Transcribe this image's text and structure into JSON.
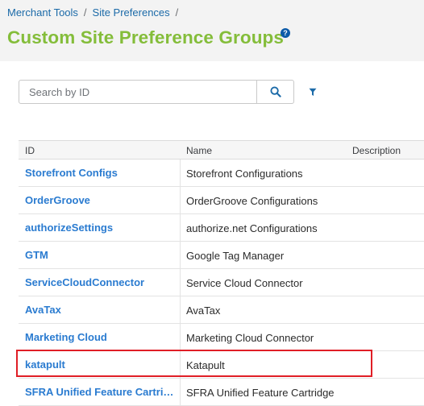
{
  "breadcrumb": {
    "items": [
      "Merchant Tools",
      "Site Preferences"
    ],
    "separator": "/"
  },
  "page": {
    "title": "Custom Site Preference Groups",
    "help_icon": "?"
  },
  "search": {
    "placeholder": "Search by ID",
    "value": ""
  },
  "icons": {
    "search": "search-icon",
    "filter": "filter-icon",
    "help": "help-icon"
  },
  "table": {
    "columns": [
      "ID",
      "Name",
      "Description"
    ],
    "rows": [
      {
        "id": "Storefront Configs",
        "name": "Storefront Configurations",
        "description": ""
      },
      {
        "id": "OrderGroove",
        "name": "OrderGroove Configurations",
        "description": ""
      },
      {
        "id": "authorizeSettings",
        "name": "authorize.net Configurations",
        "description": ""
      },
      {
        "id": "GTM",
        "name": "Google Tag Manager",
        "description": ""
      },
      {
        "id": "ServiceCloudConnector",
        "name": "Service Cloud Connector",
        "description": ""
      },
      {
        "id": "AvaTax",
        "name": "AvaTax",
        "description": ""
      },
      {
        "id": "Marketing Cloud",
        "name": "Marketing Cloud Connector",
        "description": ""
      },
      {
        "id": "katapult",
        "name": "Katapult",
        "description": ""
      },
      {
        "id": "SFRA Unified Feature Cartri…",
        "name": "SFRA Unified Feature Cartridge",
        "description": ""
      }
    ]
  },
  "colors": {
    "title": "#84bd3a",
    "link": "#2a7bd0",
    "highlight": "#e01e26",
    "header_bg": "#f3f3f3"
  }
}
